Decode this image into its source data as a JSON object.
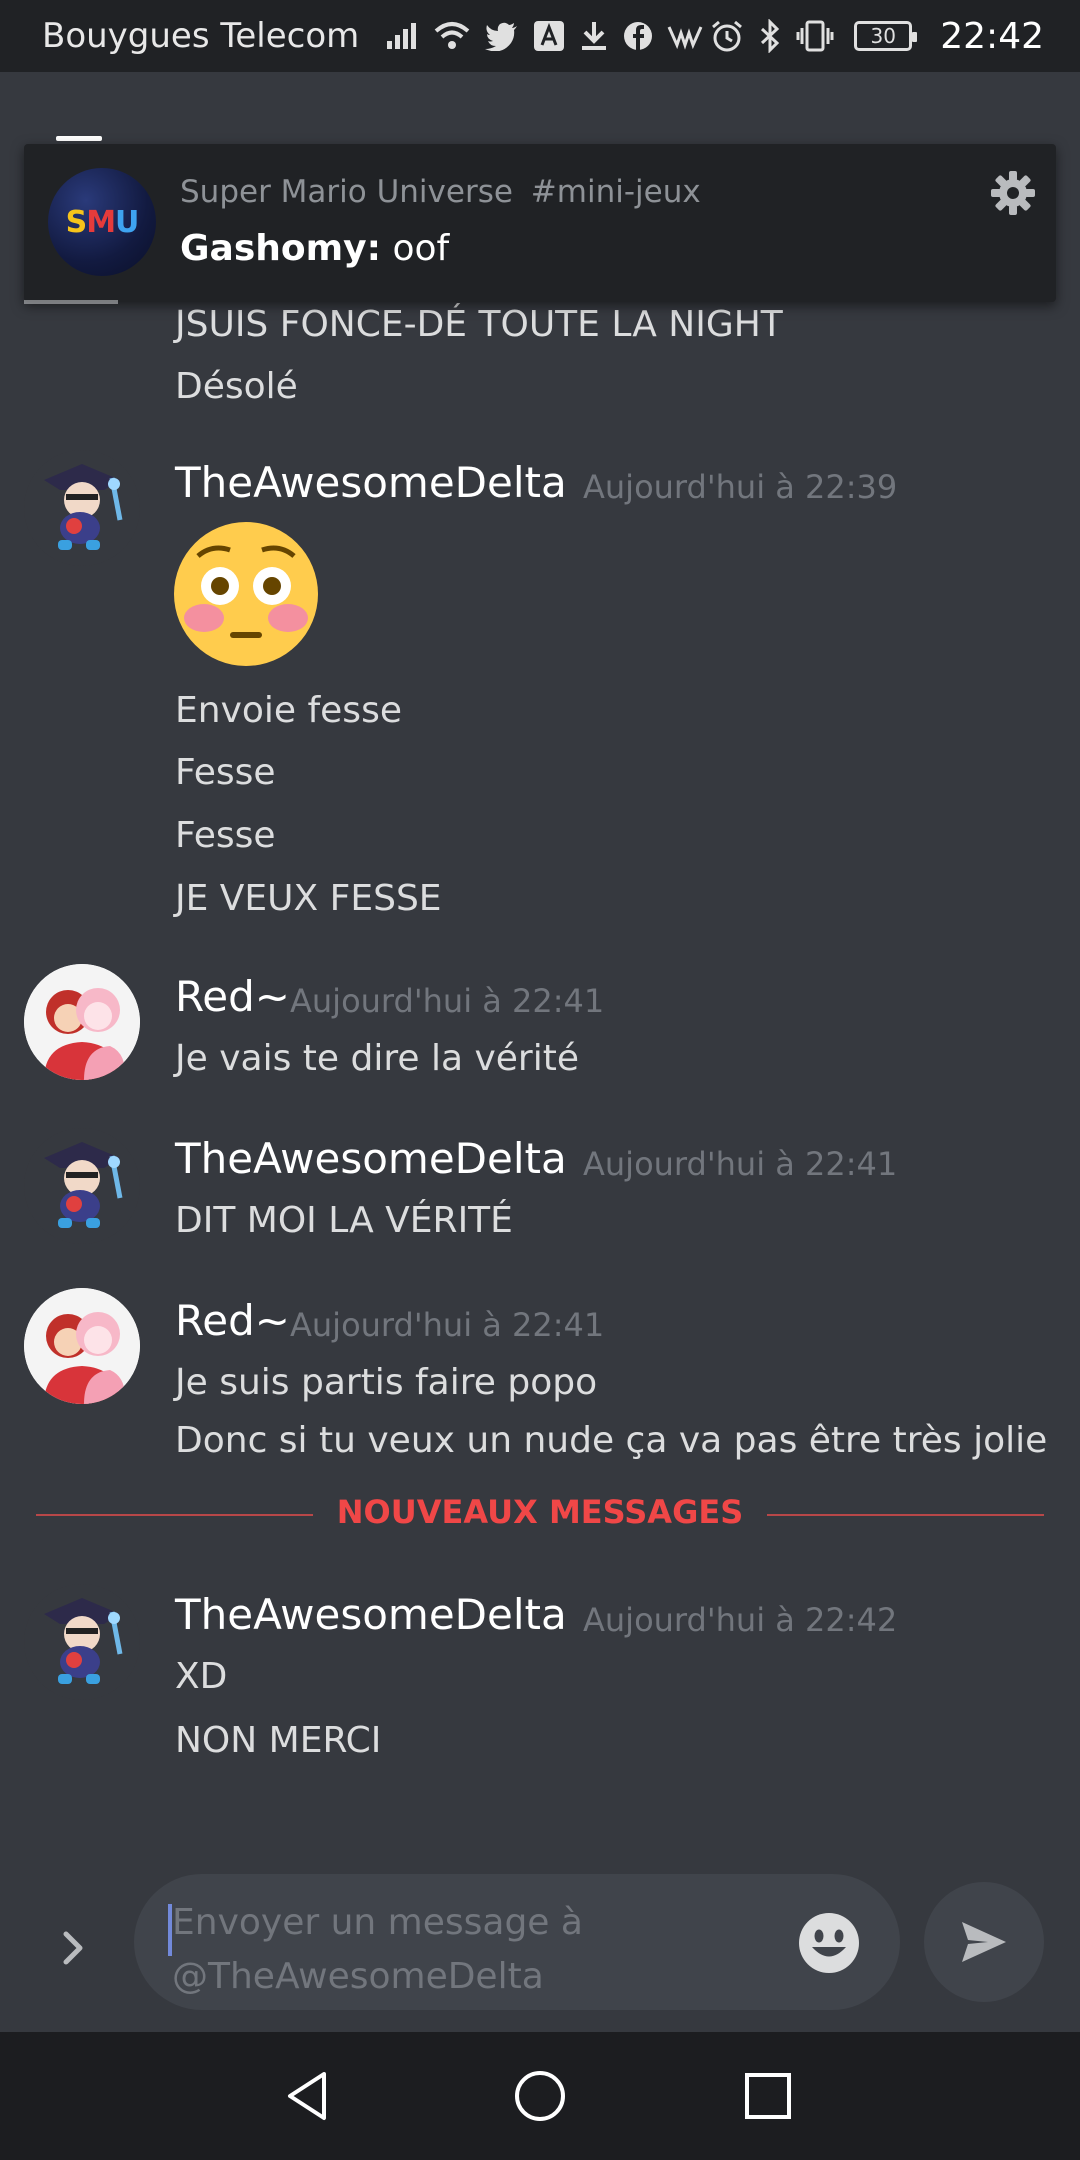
{
  "status_bar": {
    "carrier": "Bouygues Telecom",
    "battery": "30",
    "time": "22:42"
  },
  "notification": {
    "server_name": "Super Mario Universe",
    "channel": "#mini-jeux",
    "author": "Gashomy:",
    "text": "oof",
    "server_icon_text": "SMU"
  },
  "messages": [
    {
      "lines": [
        "JSUIS FONCE-DÉ TOUTE LA NIGHT",
        "Désolé"
      ]
    },
    {
      "author": "TheAwesomeDelta",
      "timestamp": "Aujourd'hui à 22:39",
      "emoji": "flushed",
      "lines": [
        "Envoie fesse",
        "Fesse",
        "Fesse",
        "JE VEUX FESSE"
      ]
    },
    {
      "author": "Red~",
      "timestamp": "Aujourd'hui à 22:41",
      "lines": [
        "Je vais te dire la vérité"
      ]
    },
    {
      "author": "TheAwesomeDelta",
      "timestamp": "Aujourd'hui à 22:41",
      "lines": [
        "DIT MOI LA VÉRITÉ"
      ]
    },
    {
      "author": "Red~",
      "timestamp": "Aujourd'hui à 22:41",
      "lines": [
        "Je suis partis faire popo",
        "Donc si tu veux un nude ça va pas être très jolie"
      ]
    },
    {
      "author": "TheAwesomeDelta",
      "timestamp": "Aujourd'hui à 22:42",
      "lines": [
        "XD",
        "NON MERCI"
      ]
    }
  ],
  "new_messages_label": "NOUVEAUX MESSAGES",
  "composer": {
    "placeholder_line1": "Envoyer un message à",
    "placeholder_line2": "@TheAwesomeDelta"
  },
  "colors": {
    "background": "#36393f",
    "new_messages": "#f04747",
    "timestamp": "#72767d"
  }
}
